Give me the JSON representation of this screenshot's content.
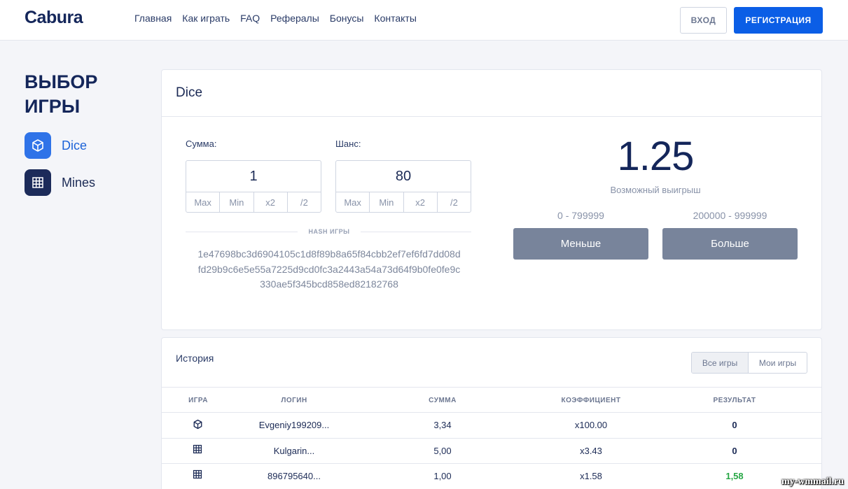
{
  "header": {
    "logo": "Cabura",
    "nav": [
      "Главная",
      "Как играть",
      "FAQ",
      "Рефералы",
      "Бонусы",
      "Контакты"
    ],
    "login_label": "ВХОД",
    "register_label": "РЕГИСТРАЦИЯ"
  },
  "sidebar": {
    "title": "ВЫБОР ИГРЫ",
    "items": [
      {
        "label": "Dice",
        "icon": "cube-icon",
        "active": true
      },
      {
        "label": "Mines",
        "icon": "grid-icon",
        "active": false
      }
    ]
  },
  "game": {
    "title": "Dice",
    "amount_label": "Сумма:",
    "amount_value": "1",
    "chance_label": "Шанс:",
    "chance_value": "80",
    "quick_buttons": [
      "Max",
      "Min",
      "x2",
      "/2"
    ],
    "hash_label": "HASH ИГРЫ",
    "hash_lines": [
      "1e47698bc3d6904105c1d8f89b8a65f84cbb2ef7ef6fd7dd08d",
      "fd29b9c6e5e55a7225d9cd0fc3a2443a54a73d64f9b0fe0fe9c",
      "330ae5f345bcd858ed82182768"
    ],
    "multiplier": "1.25",
    "possible_win_label": "Возможный выигрыш",
    "less_range": "0 - 799999",
    "more_range": "200000 - 999999",
    "less_label": "Меньше",
    "more_label": "Больше"
  },
  "history": {
    "title": "История",
    "tabs": [
      "Все игры",
      "Мои игры"
    ],
    "columns": [
      "ИГРА",
      "ЛОГИН",
      "СУММА",
      "КОЭФФИЦИЕНТ",
      "РЕЗУЛЬТАТ"
    ],
    "rows": [
      {
        "game": "cube-icon",
        "login": "Evgeniy199209...",
        "sum": "3,34",
        "coef": "x100.00",
        "result": "0"
      },
      {
        "game": "grid-icon",
        "login": "Kulgarin...",
        "sum": "5,00",
        "coef": "x3.43",
        "result": "0"
      },
      {
        "game": "grid-icon",
        "login": "896795640...",
        "sum": "1,00",
        "coef": "x1.58",
        "result": "1,58"
      }
    ]
  },
  "watermark": "my-wmmail.ru",
  "colors": {
    "accent": "#0b5ee6",
    "brand_dark": "#14265a",
    "win_green": "#27a745",
    "bet_button": "#78849b"
  }
}
